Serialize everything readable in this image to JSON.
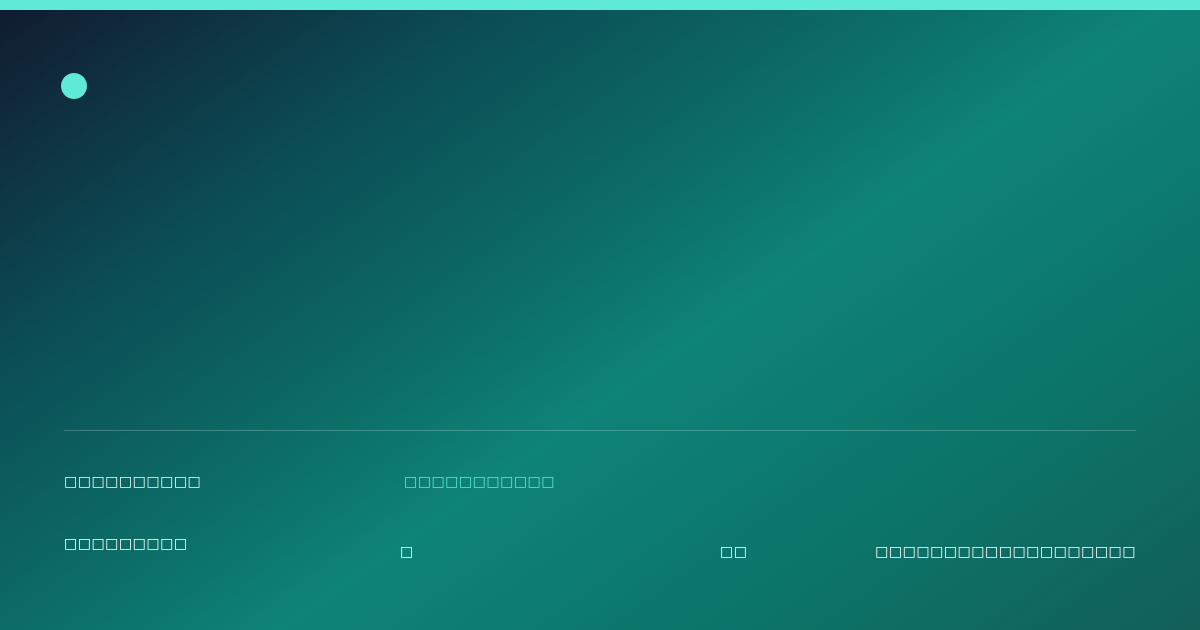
{
  "header": {
    "brand_icon": "brand-dot-icon",
    "accent_color": "#5eead4"
  },
  "footer": {
    "site_name": "□□□□□□□□□□",
    "tagline": "□□□□□□□□□□□",
    "left_text": "□□□□□□□□□",
    "middle_text_1": "□",
    "middle_text_2": "□□",
    "right_text": "□□□□□□□□□□□□□□□□□□□"
  },
  "colors": {
    "background_dark": "#111a2e",
    "background_mid": "#0e8378",
    "background_end": "#125f58",
    "accent": "#5eead4",
    "text": "#ffffff"
  }
}
